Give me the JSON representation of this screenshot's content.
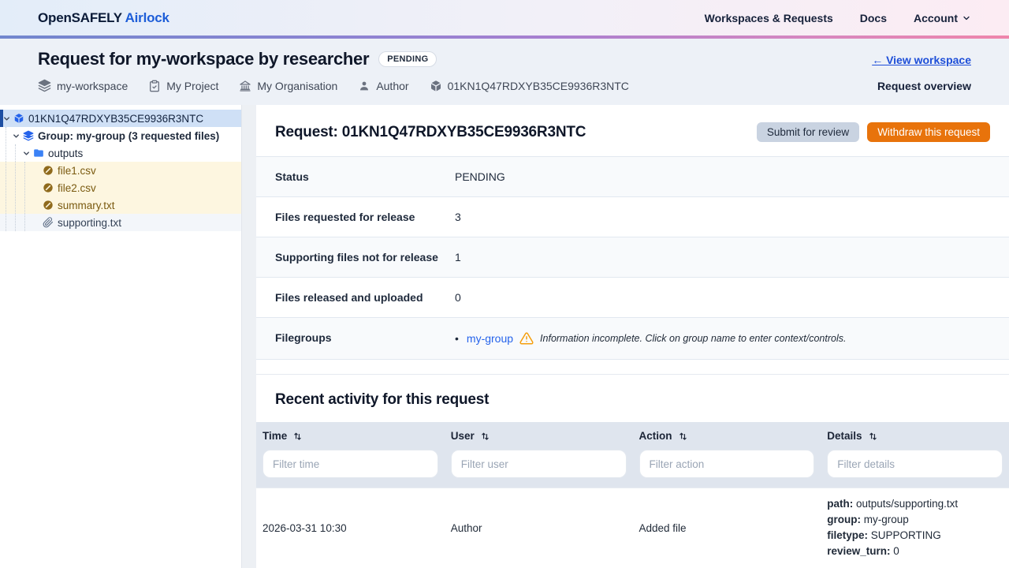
{
  "navbar": {
    "brand_primary": "OpenSAFELY",
    "brand_secondary": "Airlock",
    "links": [
      {
        "label": "Workspaces & Requests"
      },
      {
        "label": "Docs"
      },
      {
        "label": "Account"
      }
    ]
  },
  "header": {
    "title": "Request for my-workspace by researcher",
    "status_badge": "PENDING",
    "back_link": "← View workspace",
    "overview_label": "Request overview",
    "meta": [
      {
        "icon": "layers-icon",
        "label": "my-workspace"
      },
      {
        "icon": "clipboard-icon",
        "label": "My Project"
      },
      {
        "icon": "bank-icon",
        "label": "My Organisation"
      },
      {
        "icon": "user-icon",
        "label": "Author"
      },
      {
        "icon": "cube-icon",
        "label": "01KN1Q47RDXYB35CE9936R3NTC"
      }
    ]
  },
  "sidebar": {
    "items": [
      {
        "label": "01KN1Q47RDXYB35CE9936R3NTC",
        "icon": "cube-icon",
        "selected": true
      },
      {
        "label": "Group: my-group (3 requested files)",
        "icon": "layers-icon"
      },
      {
        "label": "outputs",
        "icon": "folder-icon"
      },
      {
        "label": "file1.csv",
        "icon": "pending-file-icon"
      },
      {
        "label": "file2.csv",
        "icon": "pending-file-icon"
      },
      {
        "label": "summary.txt",
        "icon": "pending-file-icon"
      },
      {
        "label": "supporting.txt",
        "icon": "paperclip-icon"
      }
    ]
  },
  "main": {
    "title": "Request: 01KN1Q47RDXYB35CE9936R3NTC",
    "submit_button": "Submit for review",
    "withdraw_button": "Withdraw this request",
    "info": [
      {
        "label": "Status",
        "value": "PENDING"
      },
      {
        "label": "Files requested for release",
        "value": "3"
      },
      {
        "label": "Supporting files not for release",
        "value": "1"
      },
      {
        "label": "Files released and uploaded",
        "value": "0"
      }
    ],
    "filegroups": {
      "label": "Filegroups",
      "group_link": "my-group",
      "warning_note": "Information incomplete. Click on group name to enter context/controls."
    },
    "activity": {
      "title": "Recent activity for this request",
      "columns": [
        {
          "label": "Time",
          "filter_placeholder": "Filter time"
        },
        {
          "label": "User",
          "filter_placeholder": "Filter user"
        },
        {
          "label": "Action",
          "filter_placeholder": "Filter action"
        },
        {
          "label": "Details",
          "filter_placeholder": "Filter details"
        }
      ],
      "rows": [
        {
          "time": "2026-03-31 10:30",
          "user": "Author",
          "action": "Added file",
          "details": [
            {
              "key": "path:",
              "value": "outputs/supporting.txt"
            },
            {
              "key": "group:",
              "value": "my-group"
            },
            {
              "key": "filetype:",
              "value": "SUPPORTING"
            },
            {
              "key": "review_turn:",
              "value": "0"
            }
          ]
        }
      ]
    }
  },
  "colors": {
    "accent_blue": "#2563eb",
    "link_blue": "#1d4ed8",
    "withdraw_orange": "#e8730b",
    "warning_orange": "#f59e0b",
    "selected_row_bg": "#cfe0f6",
    "pending_file_bg": "#fdf6e0",
    "pending_file_text": "#7a5a10",
    "table_header_bg": "#dfe5ee"
  }
}
